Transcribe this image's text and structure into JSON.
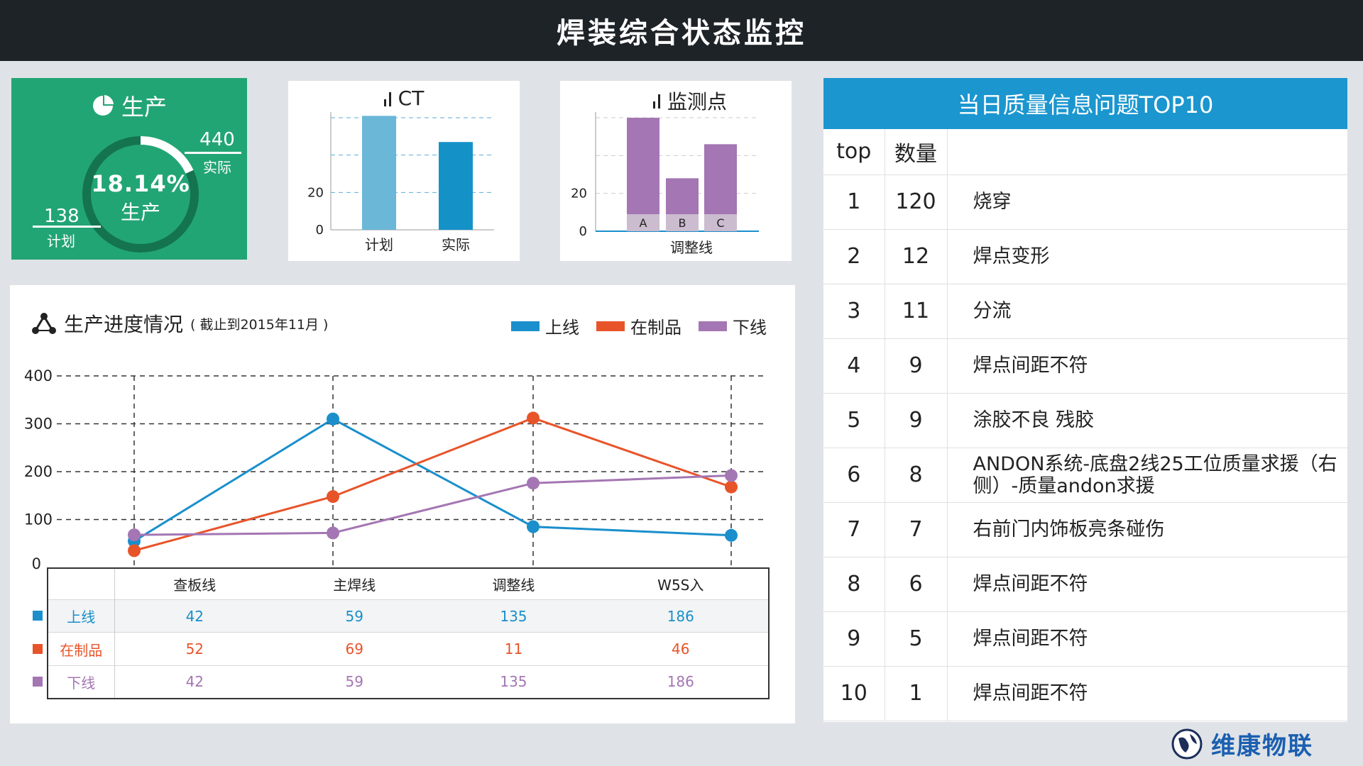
{
  "page": {
    "title": "焊装综合状态监控"
  },
  "production": {
    "title": "生产",
    "percent_text": "18.14%",
    "percent_label": "生产",
    "progress_fraction": 0.1814,
    "actual_value": "440",
    "actual_label": "实际",
    "plan_value": "138",
    "plan_label": "计划"
  },
  "ct_chart": {
    "title": "CT",
    "ticks": [
      "0",
      "20"
    ],
    "categories": [
      "计划",
      "实际"
    ],
    "values": [
      61,
      47
    ],
    "ylim": [
      0,
      60
    ],
    "colors": [
      "#6ab7d8",
      "#1492c8"
    ]
  },
  "monitor_chart": {
    "title": "监测点",
    "ticks": [
      "0",
      "20"
    ],
    "categories": [
      "A",
      "B",
      "C"
    ],
    "values": [
      60,
      28,
      46
    ],
    "ylim": [
      0,
      60
    ],
    "xlabel": "调整线",
    "color": "#a476b3"
  },
  "progress": {
    "title": "生产进度情况",
    "subtitle": "( 截止到2015年11月 )",
    "legend": [
      {
        "label": "上线",
        "color": "#1a8fcc"
      },
      {
        "label": "在制品",
        "color": "#e8542a"
      },
      {
        "label": "下线",
        "color": "#a476b3"
      }
    ],
    "table_header": [
      "查板线",
      "主焊线",
      "调整线",
      "W5S入"
    ],
    "table_rows": [
      {
        "label": "上线",
        "color": "#1a8fcc",
        "values": [
          "42",
          "59",
          "135",
          "186"
        ]
      },
      {
        "label": "在制品",
        "color": "#e8542a",
        "values": [
          "52",
          "69",
          "11",
          "46"
        ]
      },
      {
        "label": "下线",
        "color": "#a476b3",
        "values": [
          "42",
          "59",
          "135",
          "186"
        ]
      }
    ]
  },
  "chart_data": {
    "type": "line",
    "categories": [
      "查板线",
      "主焊线",
      "调整线",
      "W5S入"
    ],
    "ylim": [
      0,
      400
    ],
    "yticks": [
      "0",
      "100",
      "200",
      "300",
      "400"
    ],
    "grid": true,
    "legend_position": "top-right",
    "series": [
      {
        "name": "上线",
        "color": "#1a8fcc",
        "values": [
          55,
          310,
          85,
          67
        ]
      },
      {
        "name": "在制品",
        "color": "#e8542a",
        "values": [
          35,
          148,
          312,
          168
        ]
      },
      {
        "name": "下线",
        "color": "#a476b3",
        "values": [
          68,
          72,
          176,
          192
        ]
      }
    ]
  },
  "top10": {
    "title": "当日质量信息问题TOP10",
    "headers": [
      "top",
      "数量",
      ""
    ],
    "rows": [
      {
        "rank": "1",
        "count": "120",
        "issue": "烧穿"
      },
      {
        "rank": "2",
        "count": "12",
        "issue": "焊点变形"
      },
      {
        "rank": "3",
        "count": "11",
        "issue": "分流"
      },
      {
        "rank": "4",
        "count": "9",
        "issue": "焊点间距不符"
      },
      {
        "rank": "5",
        "count": "9",
        "issue": "涂胶不良 残胶"
      },
      {
        "rank": "6",
        "count": "8",
        "issue": "ANDON系统-底盘2线25工位质量求援（右侧）-质量andon求援"
      },
      {
        "rank": "7",
        "count": "7",
        "issue": "右前门内饰板亮条碰伤"
      },
      {
        "rank": "8",
        "count": "6",
        "issue": "焊点间距不符"
      },
      {
        "rank": "9",
        "count": "5",
        "issue": "焊点间距不符"
      },
      {
        "rank": "10",
        "count": "1",
        "issue": "焊点间距不符"
      }
    ]
  },
  "brand": {
    "name": "维康物联"
  }
}
